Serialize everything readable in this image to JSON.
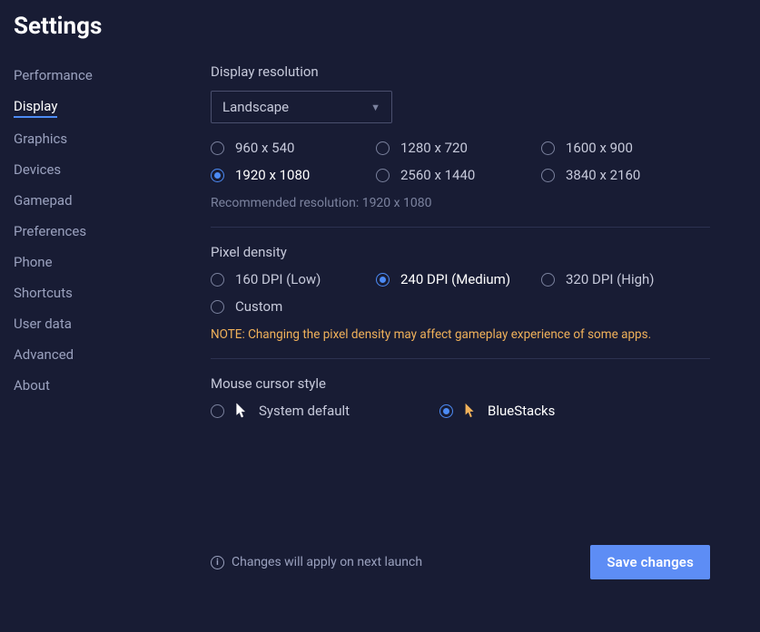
{
  "title": "Settings",
  "sidebar": {
    "items": [
      {
        "label": "Performance"
      },
      {
        "label": "Display",
        "active": true
      },
      {
        "label": "Graphics"
      },
      {
        "label": "Devices"
      },
      {
        "label": "Gamepad"
      },
      {
        "label": "Preferences"
      },
      {
        "label": "Phone"
      },
      {
        "label": "Shortcuts"
      },
      {
        "label": "User data"
      },
      {
        "label": "Advanced"
      },
      {
        "label": "About"
      }
    ]
  },
  "display": {
    "resolution_label": "Display resolution",
    "orientation_selected": "Landscape",
    "resolutions": [
      {
        "label": "960 x 540"
      },
      {
        "label": "1280 x 720"
      },
      {
        "label": "1600 x 900"
      },
      {
        "label": "1920 x 1080",
        "selected": true
      },
      {
        "label": "2560 x 1440"
      },
      {
        "label": "3840 x 2160"
      }
    ],
    "recommended": "Recommended resolution: 1920 x 1080"
  },
  "density": {
    "label": "Pixel density",
    "options": [
      {
        "label": "160 DPI (Low)"
      },
      {
        "label": "240 DPI (Medium)",
        "selected": true
      },
      {
        "label": "320 DPI (High)"
      },
      {
        "label": "Custom"
      }
    ],
    "note": "NOTE: Changing the pixel density may affect gameplay experience of some apps."
  },
  "cursor": {
    "label": "Mouse cursor style",
    "options": [
      {
        "label": "System default"
      },
      {
        "label": "BlueStacks",
        "selected": true
      }
    ]
  },
  "footer": {
    "apply_note": "Changes will apply on next launch",
    "save_label": "Save changes"
  }
}
